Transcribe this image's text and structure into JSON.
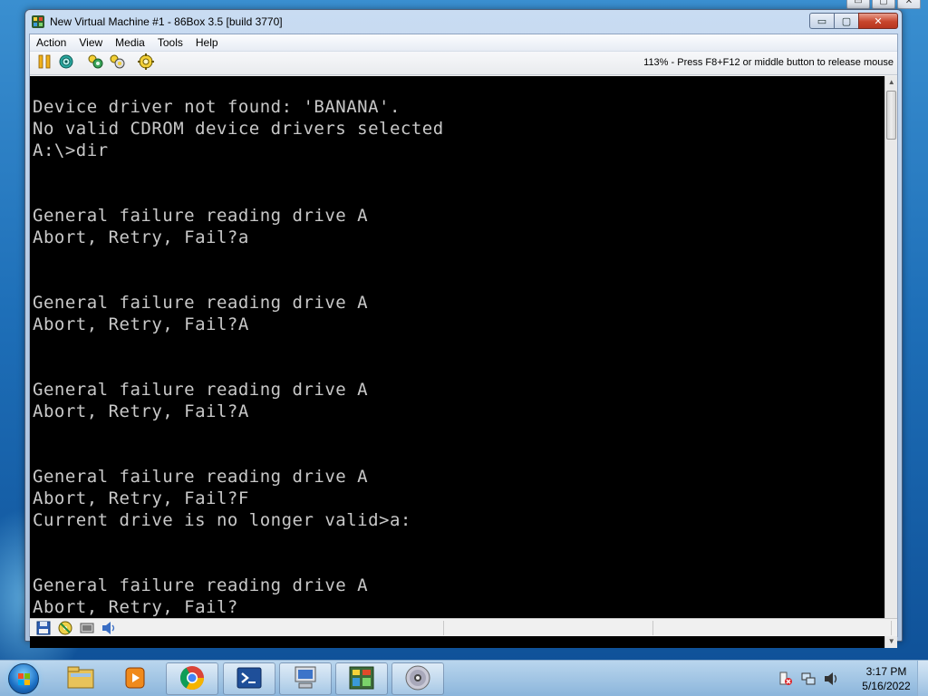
{
  "window": {
    "title": "New Virtual Machine #1 - 86Box 3.5 [build 3770]",
    "controls": {
      "minimize": "▭",
      "maximize": "▢",
      "close": "✕"
    }
  },
  "menu": [
    "Action",
    "View",
    "Media",
    "Tools",
    "Help"
  ],
  "toolbar": {
    "buttons": [
      "pause-icon",
      "ctrl-alt-del-icon",
      "reset-icon",
      "hard-reset-icon",
      "settings-icon"
    ],
    "status_text": "113% - Press F8+F12 or middle button to release mouse"
  },
  "console": {
    "lines": [
      "Device driver not found: 'BANANA'.",
      "No valid CDROM device drivers selected",
      "A:\\>dir",
      "",
      "",
      "General failure reading drive A",
      "Abort, Retry, Fail?a",
      "",
      "",
      "General failure reading drive A",
      "Abort, Retry, Fail?A",
      "",
      "",
      "General failure reading drive A",
      "Abort, Retry, Fail?A",
      "",
      "",
      "General failure reading drive A",
      "Abort, Retry, Fail?F",
      "Current drive is no longer valid>a:",
      "",
      "",
      "General failure reading drive A",
      "Abort, Retry, Fail?"
    ]
  },
  "statusbar": {
    "icons": [
      "floppy-icon",
      "cdrom-icon",
      "network-icon",
      "sound-icon"
    ]
  },
  "taskbar": {
    "apps": [
      "explorer-icon",
      "media-player-icon",
      "chrome-icon",
      "powershell-icon",
      "virtual-pc-icon",
      "86box-icon",
      "dvd-icon"
    ],
    "clock": {
      "time": "3:17 PM",
      "date": "5/16/2022"
    }
  },
  "colors": {
    "console_bg": "#000000",
    "console_fg": "#c8c8c8",
    "close_button": "#c8452c",
    "desktop": "#1e6fb8"
  }
}
